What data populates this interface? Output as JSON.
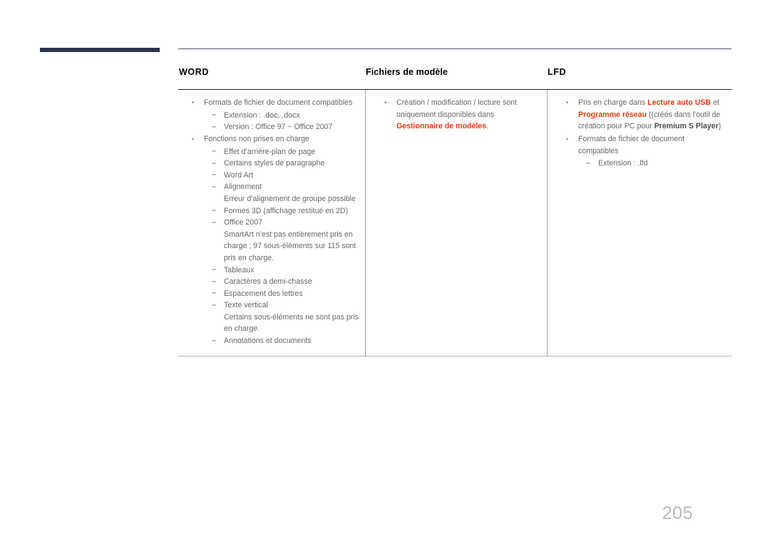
{
  "page": {
    "number": "205",
    "accent_navy": "#2b3452",
    "accent_red": "#e33b0e",
    "body_text_color": "#676767"
  },
  "table": {
    "columns": [
      {
        "title": "WORD"
      },
      {
        "title": "Fichiers de modèle"
      },
      {
        "title": "LFD"
      }
    ],
    "word_column": [
      {
        "level": 1,
        "marker": "•",
        "text": "Formats de fichier de document compatibles"
      },
      {
        "level": 2,
        "marker": "–",
        "text": "Extension : .doc, .docx"
      },
      {
        "level": 2,
        "marker": "–",
        "text": "Version : Office 97 ~ Office 2007"
      },
      {
        "level": 1,
        "marker": "•",
        "text": "Fonctions non prises en charge"
      },
      {
        "level": 2,
        "marker": "–",
        "text": "Effet d’arrière-plan de page"
      },
      {
        "level": 2,
        "marker": "–",
        "text": "Certains styles de paragraphe"
      },
      {
        "level": 2,
        "marker": "–",
        "text": "Word Art"
      },
      {
        "level": 2,
        "marker": "–",
        "text": "Alignement"
      },
      {
        "level": 0,
        "marker": "",
        "text": "Erreur d’alignement de groupe possible"
      },
      {
        "level": 2,
        "marker": "–",
        "text": "Formes 3D (affichage restitué en 2D)"
      },
      {
        "level": 2,
        "marker": "–",
        "text": "Office 2007"
      },
      {
        "level": 0,
        "marker": "",
        "text": "SmartArt n’est pas entièrement pris en charge ; 97 sous-éléments sur 115 sont pris en charge."
      },
      {
        "level": 2,
        "marker": "–",
        "text": "Tableaux"
      },
      {
        "level": 2,
        "marker": "–",
        "text": "Caractères à demi-chasse"
      },
      {
        "level": 2,
        "marker": "–",
        "text": "Espacement des lettres"
      },
      {
        "level": 2,
        "marker": "–",
        "text": "Texte vertical"
      },
      {
        "level": 0,
        "marker": "",
        "text": "Certains sous-éléments ne sont pas pris en charge."
      },
      {
        "level": 2,
        "marker": "–",
        "text": "Annotations et documents"
      }
    ],
    "template_column": {
      "bullet_marker": "•",
      "line_1": "Création / modification / lecture sont",
      "line_2_pre": "uniquement disponibles dans ",
      "line_2_hl": "Gestionnaire",
      "line_3_hl": "de modèles",
      "line_3_post": "."
    },
    "lfd_column": {
      "item1": {
        "marker": "•",
        "pre": "Pris en charge dans ",
        "hl1": "Lecture auto USB",
        "mid": " et",
        "hl2": "Programme réseau",
        "paren_open": " ((créés dans l'outil de",
        "line3_pre": "création pour PC pour ",
        "bold": "Premium S Player",
        "paren_close": ")"
      },
      "item2": {
        "marker": "•",
        "text": "Formats de fichier de document compatibles"
      },
      "item3": {
        "marker": "–",
        "text": "Extension : .lfd"
      }
    }
  }
}
